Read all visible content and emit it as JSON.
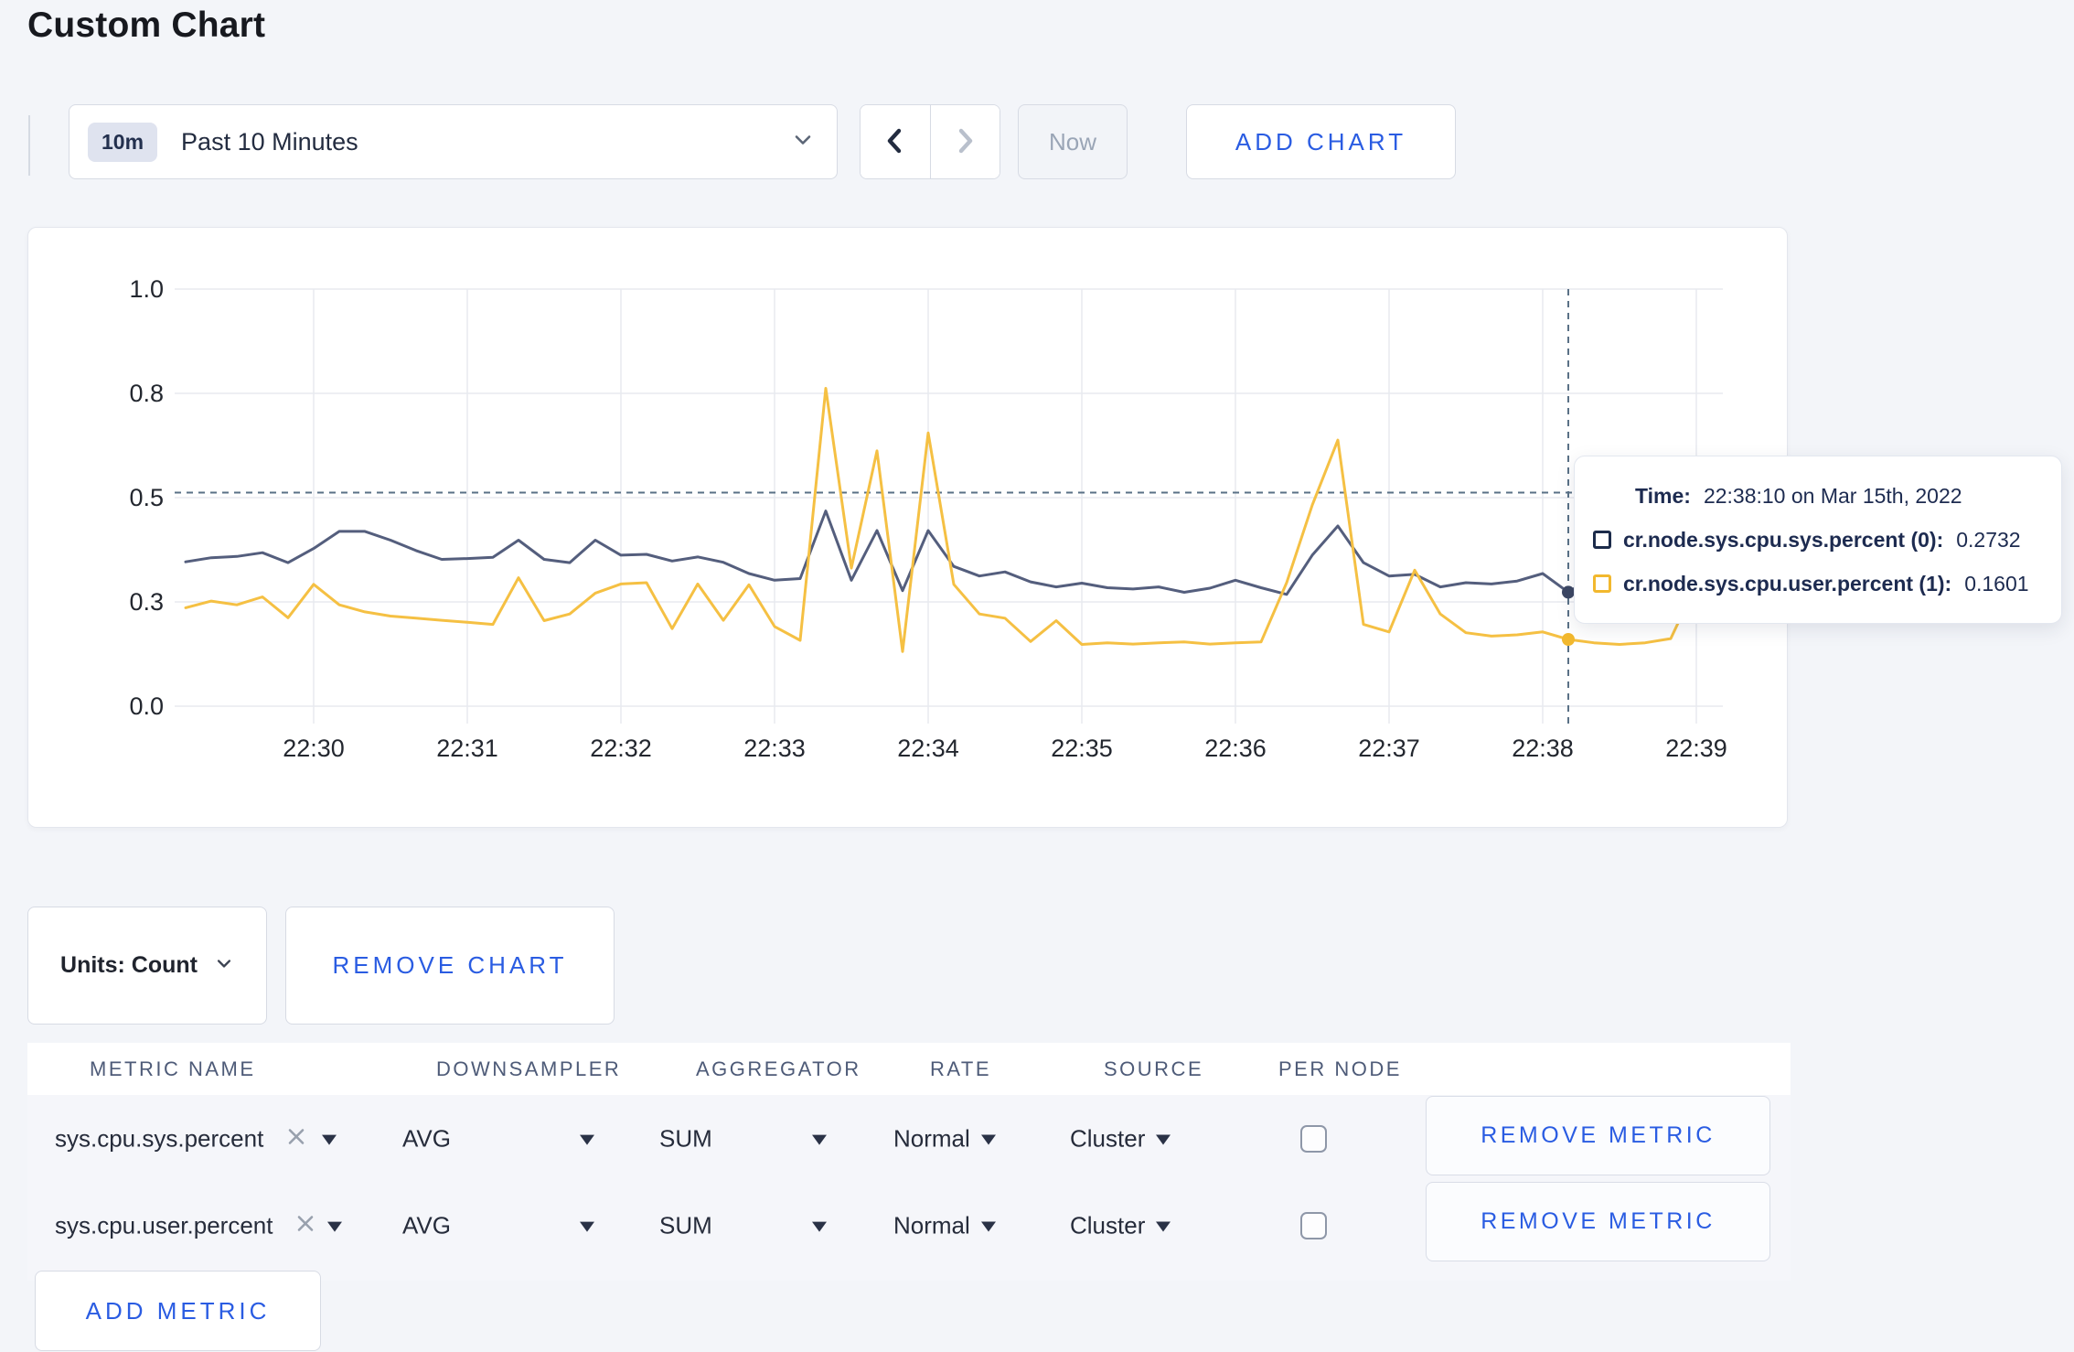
{
  "page": {
    "title": "Custom Chart",
    "background": "#f3f5f9",
    "accent": "#2a5ce2"
  },
  "toolbar": {
    "time_window_badge": "10m",
    "time_window_label": "Past 10 Minutes",
    "now_label": "Now",
    "add_chart_label": "ADD CHART"
  },
  "icons": {
    "time_window_caret": "chevron-down",
    "prev_nav": "chevron-left",
    "next_nav": "chevron-right",
    "units_caret": "chevron-down",
    "metric_remove": "x-cross",
    "select_caret": "triangle-down"
  },
  "chart_data": {
    "type": "line",
    "title": "",
    "start_time": "22:29:10",
    "interval_seconds": 10,
    "x_tick_labels": [
      "22:30",
      "22:31",
      "22:32",
      "22:33",
      "22:34",
      "22:35",
      "22:36",
      "22:37",
      "22:38",
      "22:39"
    ],
    "y_ticks": [
      {
        "label": "1.0",
        "value": 1.0
      },
      {
        "label": "0.8",
        "value": 0.75
      },
      {
        "label": "0.5",
        "value": 0.5
      },
      {
        "label": "0.3",
        "value": 0.25
      },
      {
        "label": "0.0",
        "value": 0.0
      }
    ],
    "ylim": [
      0,
      1
    ],
    "grid": true,
    "gridline_color": "#e8eaef",
    "axis_text_color": "#23272f",
    "series": [
      {
        "name": "cr.node.sys.cpu.sys.percent (0)",
        "color": "#545e7d",
        "dot_color": "#3c4763",
        "values": [
          0.346,
          0.356,
          0.359,
          0.368,
          0.344,
          0.378,
          0.419,
          0.419,
          0.398,
          0.373,
          0.352,
          0.354,
          0.357,
          0.398,
          0.352,
          0.344,
          0.398,
          0.362,
          0.364,
          0.348,
          0.358,
          0.345,
          0.318,
          0.302,
          0.306,
          0.468,
          0.302,
          0.421,
          0.277,
          0.421,
          0.335,
          0.312,
          0.322,
          0.298,
          0.286,
          0.295,
          0.284,
          0.281,
          0.286,
          0.273,
          0.283,
          0.302,
          0.284,
          0.268,
          0.362,
          0.432,
          0.344,
          0.312,
          0.316,
          0.286,
          0.296,
          0.293,
          0.3,
          0.318,
          0.2732,
          0.312,
          0.295,
          0.285,
          0.288,
          0.292,
          0.282
        ]
      },
      {
        "name": "cr.node.sys.cpu.user.percent (1)",
        "color": "#f5c043",
        "dot_color": "#f2b82e",
        "values": [
          0.236,
          0.252,
          0.243,
          0.262,
          0.212,
          0.292,
          0.243,
          0.226,
          0.216,
          0.211,
          0.206,
          0.201,
          0.196,
          0.308,
          0.205,
          0.221,
          0.271,
          0.293,
          0.296,
          0.186,
          0.293,
          0.206,
          0.291,
          0.191,
          0.158,
          0.762,
          0.331,
          0.612,
          0.131,
          0.655,
          0.292,
          0.221,
          0.211,
          0.155,
          0.205,
          0.148,
          0.152,
          0.149,
          0.152,
          0.154,
          0.149,
          0.152,
          0.154,
          0.296,
          0.482,
          0.638,
          0.196,
          0.178,
          0.326,
          0.221,
          0.176,
          0.168,
          0.171,
          0.178,
          0.1601,
          0.152,
          0.148,
          0.152,
          0.162,
          0.292,
          0.238
        ]
      }
    ],
    "crosshair": {
      "index": 54,
      "time": "22:38:10",
      "y_fraction": 0.512,
      "color": "#5a7186"
    }
  },
  "tooltip": {
    "time_label": "Time:",
    "time_value": "22:38:10 on Mar 15th, 2022",
    "entries": [
      {
        "label": "cr.node.sys.cpu.sys.percent (0):",
        "value": "0.2732",
        "swatch_color": "#1c2b4a"
      },
      {
        "label": "cr.node.sys.cpu.user.percent (1):",
        "value": "0.1601",
        "swatch_color": "#f2b82e"
      }
    ]
  },
  "chart_footer": {
    "units_label": "Units: Count",
    "remove_chart_label": "REMOVE CHART"
  },
  "metrics_table": {
    "headers": [
      "METRIC NAME",
      "DOWNSAMPLER",
      "AGGREGATOR",
      "RATE",
      "SOURCE",
      "PER NODE"
    ],
    "rows": [
      {
        "metric": "sys.cpu.sys.percent",
        "downsampler": "AVG",
        "aggregator": "SUM",
        "rate": "Normal",
        "source": "Cluster",
        "per_node_checked": false,
        "remove_label": "REMOVE METRIC"
      },
      {
        "metric": "sys.cpu.user.percent",
        "downsampler": "AVG",
        "aggregator": "SUM",
        "rate": "Normal",
        "source": "Cluster",
        "per_node_checked": false,
        "remove_label": "REMOVE METRIC"
      }
    ],
    "add_metric_label": "ADD METRIC"
  }
}
